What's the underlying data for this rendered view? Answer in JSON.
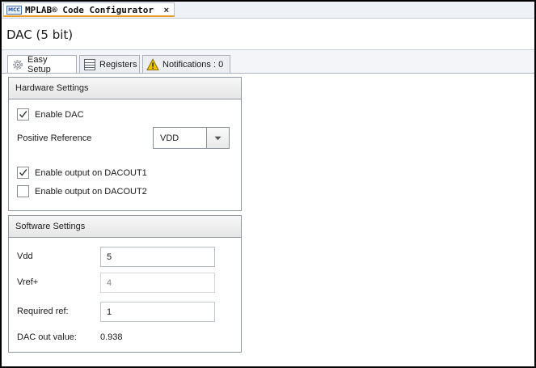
{
  "doc_tab": {
    "logo": "MCC",
    "title": "MPLAB® Code Configurator",
    "close": "×"
  },
  "page_title": "DAC (5 bit)",
  "tabs": [
    {
      "label": "Easy Setup",
      "icon": "gear-icon"
    },
    {
      "label": "Registers",
      "icon": "registers-icon"
    },
    {
      "label": "Notifications : 0",
      "icon": "warning-icon"
    }
  ],
  "hardware": {
    "header": "Hardware Settings",
    "enable_dac": {
      "label": "Enable DAC",
      "checked": true
    },
    "positive_reference": {
      "label": "Positive Reference",
      "value": "VDD"
    },
    "dacout1": {
      "label": "Enable output on DACOUT1",
      "checked": true
    },
    "dacout2": {
      "label": "Enable output on DACOUT2",
      "checked": false
    }
  },
  "software": {
    "header": "Software Settings",
    "vdd": {
      "label": "Vdd",
      "value": "5"
    },
    "vref": {
      "label": "Vref+",
      "value": "4"
    },
    "required_ref": {
      "label": "Required ref:",
      "value": "1"
    },
    "dac_out": {
      "label": "DAC out value:",
      "value": "0.938"
    }
  },
  "colors": {
    "accent_tab_underline": "#e79b2b",
    "panel_border": "#8f96a0",
    "warning": "#f2c200"
  }
}
